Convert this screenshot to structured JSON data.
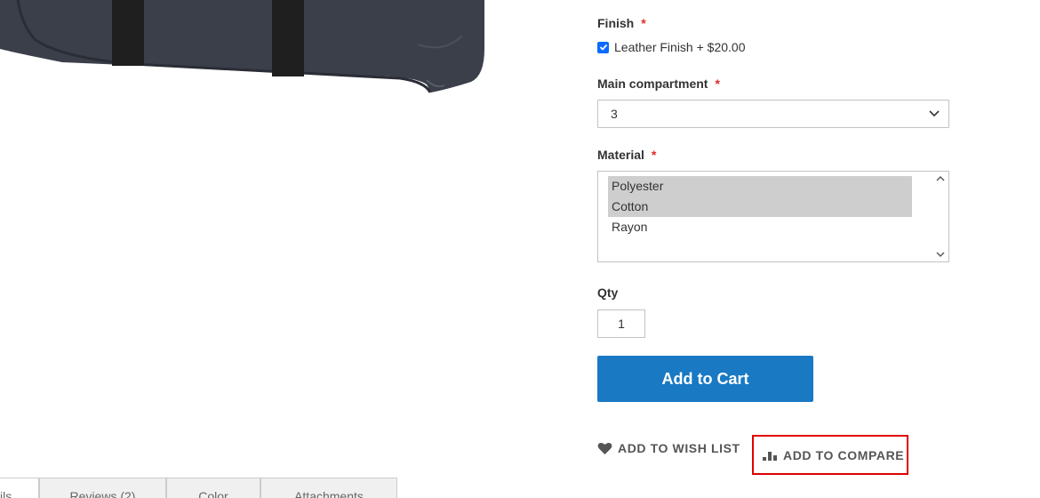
{
  "options": {
    "finish": {
      "label": "Finish",
      "required_mark": "*",
      "checkbox_label": "Leather Finish + $20.00",
      "checked": true
    },
    "main_compartment": {
      "label": "Main compartment",
      "required_mark": "*",
      "selected_value": "3"
    },
    "material": {
      "label": "Material",
      "required_mark": "*",
      "options": [
        {
          "text": "Polyester",
          "selected": true
        },
        {
          "text": "Cotton",
          "selected": true
        },
        {
          "text": "Rayon",
          "selected": false
        }
      ]
    },
    "qty": {
      "label": "Qty",
      "value": "1"
    }
  },
  "add_to_cart_label": "Add to Cart",
  "actions": {
    "wish_list_label": "ADD TO WISH LIST",
    "compare_label": "ADD TO COMPARE"
  },
  "tabs": [
    {
      "label": "ils",
      "active": true
    },
    {
      "label": "Reviews (2)",
      "active": false
    },
    {
      "label": "Color",
      "active": false
    },
    {
      "label": "Attachments",
      "active": false
    }
  ],
  "colors": {
    "primary_button": "#1979c3",
    "required": "#e02b27",
    "highlight_box": "#e00000",
    "checkbox": "#0a6cff"
  }
}
